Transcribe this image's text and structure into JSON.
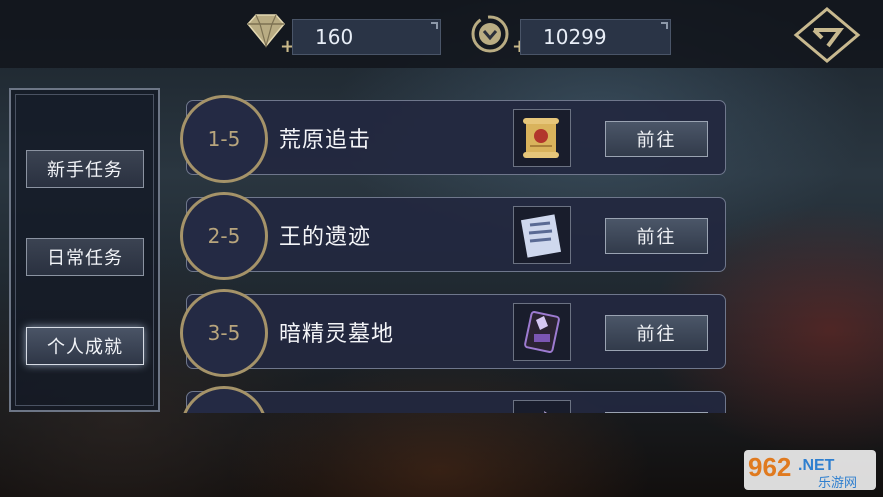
{
  "resources": {
    "diamond": {
      "value": "160",
      "icon": "diamond-icon"
    },
    "coin": {
      "value": "10299",
      "icon": "coin-icon"
    }
  },
  "back_icon": "back-arrow-icon",
  "sidebar": {
    "items": [
      {
        "label": "新手任务",
        "active": false
      },
      {
        "label": "日常任务",
        "active": false
      },
      {
        "label": "个人成就",
        "active": true
      }
    ]
  },
  "tasks": [
    {
      "level": "1-5",
      "title": "荒原追击",
      "item_icon": "scroll-icon",
      "button": "前往"
    },
    {
      "level": "2-5",
      "title": "王的遗迹",
      "item_icon": "map-icon",
      "button": "前往"
    },
    {
      "level": "3-5",
      "title": "暗精灵墓地",
      "item_icon": "gem-card-icon",
      "button": "前往"
    },
    {
      "level": "",
      "title": "",
      "item_icon": "item-icon",
      "button": ""
    }
  ],
  "watermark": {
    "number": "962",
    "tld": ".NET",
    "text": "乐游网"
  },
  "colors": {
    "accent_gold": "#a59369",
    "panel": "#222840"
  }
}
